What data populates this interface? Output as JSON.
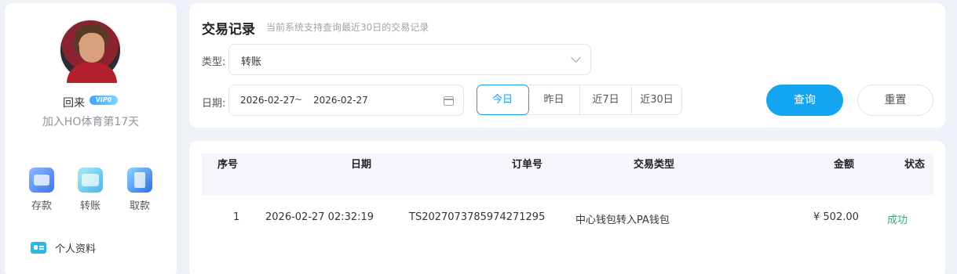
{
  "user": {
    "name": "回来",
    "vip_badge": "VIP0",
    "join_text": "加入HO体育第17天"
  },
  "quick_actions": [
    {
      "label": "存款",
      "icon": "deposit-icon"
    },
    {
      "label": "转账",
      "icon": "transfer-icon"
    },
    {
      "label": "取款",
      "icon": "withdraw-icon"
    }
  ],
  "menu": {
    "profile_label": "个人资料",
    "profile_icon": "id-card-icon"
  },
  "filter": {
    "title": "交易记录",
    "subtitle": "当前系统支持查询最近30日的交易记录",
    "type_label": "类型:",
    "type_value": "转账",
    "date_label": "日期:",
    "date_start": "2026-02-27",
    "date_separator": "~",
    "date_end": "2026-02-27",
    "quick_ranges": [
      {
        "label": "今日",
        "active": true
      },
      {
        "label": "昨日",
        "active": false
      },
      {
        "label": "近7日",
        "active": false
      },
      {
        "label": "近30日",
        "active": false
      }
    ],
    "query_label": "查询",
    "reset_label": "重置"
  },
  "table": {
    "headers": {
      "index": "序号",
      "date": "日期",
      "order_no": "订单号",
      "type": "交易类型",
      "amount": "金额",
      "status": "状态"
    },
    "rows": [
      {
        "index": "1",
        "date": "2026-02-27 02:32:19",
        "order_no": "TS2027073785974271295",
        "type": "中心钱包转入PA钱包",
        "amount": "¥ 502.00",
        "status": "成功"
      }
    ]
  },
  "colors": {
    "accent": "#13a5f2",
    "success": "#2eae6b",
    "background": "#eef1f7"
  }
}
